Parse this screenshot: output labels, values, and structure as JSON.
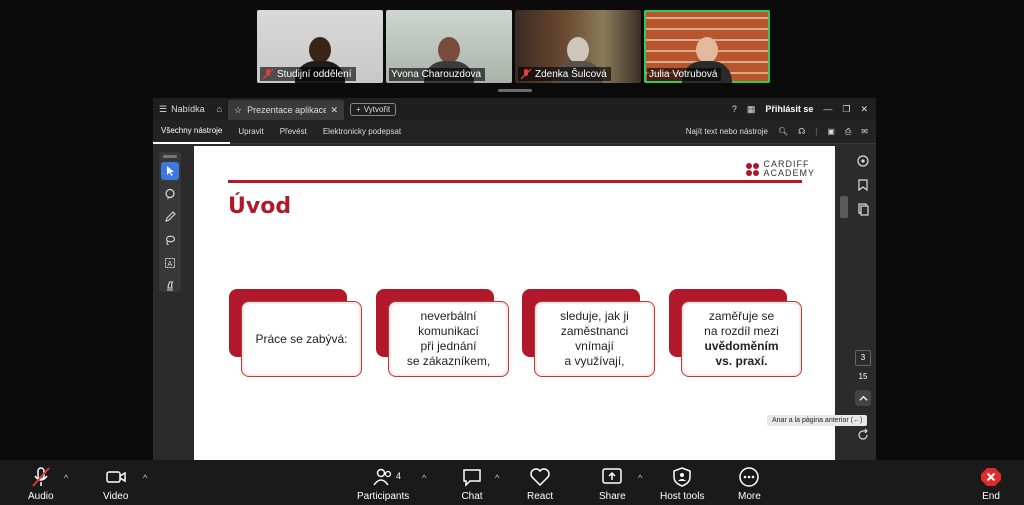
{
  "participants": [
    {
      "name": "Studijní oddělení",
      "muted": true
    },
    {
      "name": "Yvona Charouzdova",
      "muted": false
    },
    {
      "name": "Zdenka Šulcová",
      "muted": true
    },
    {
      "name": "Julia Votrubová",
      "muted": false,
      "speaking": true
    }
  ],
  "acrobat": {
    "menu_label": "Nabídka",
    "tab_title": "Prezentace aplikace ...",
    "new_tab_label": "Vytvořit",
    "sign_in": "Přihlásit se",
    "menubar": [
      "Všechny nástroje",
      "Upravit",
      "Převést",
      "Elektronicky podepsat"
    ],
    "search_label": "Najít text nebo nástroje",
    "page_current": "3",
    "page_total": "15",
    "tooltip": "Anar a la pàgina anterior (←)"
  },
  "slide": {
    "logo_line1": "CARDIFF",
    "logo_line2": "ACADEMY",
    "title": "Úvod",
    "box1": "Práce se zabývá:",
    "box2_l1": "neverbální",
    "box2_l2": "komunikací",
    "box2_l3": "při jednání",
    "box2_l4": "se zákazníkem,",
    "box3_l1": "sleduje, jak ji",
    "box3_l2": "zaměstnanci",
    "box3_l3": "vnímají",
    "box3_l4": "a využívají,",
    "box4_l1": "zaměřuje se",
    "box4_l2": "na rozdíl mezi",
    "box4_l3": "uvědoměním",
    "box4_l4": "vs. praxí."
  },
  "zoom_toolbar": {
    "audio": "Audio",
    "video": "Video",
    "participants": "Participants",
    "participants_count": "4",
    "chat": "Chat",
    "react": "React",
    "share": "Share",
    "host_tools": "Host tools",
    "more": "More",
    "end": "End"
  }
}
